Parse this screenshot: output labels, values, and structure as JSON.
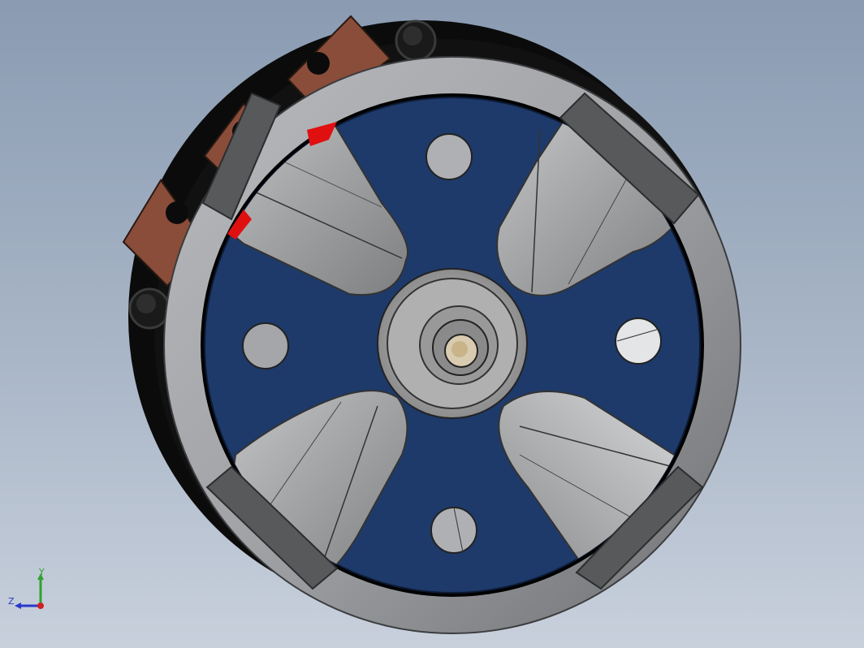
{
  "viewport": {
    "background_top": "#8a9bb2",
    "background_bottom": "#c8d0dc"
  },
  "model": {
    "body_color": "#0b0b0b",
    "rim_color": "#a8aaad",
    "hub_face_color": "#1e3a6a",
    "blade_color": "#9a9b9d",
    "terminal_color": "#8a4d3a",
    "accent_color": "#e01010"
  },
  "triad": {
    "y_label": "Y",
    "z_label": "Z",
    "y_axis_color": "#2fa32f",
    "z_axis_color": "#2b39c9",
    "origin_color": "#d02020"
  }
}
